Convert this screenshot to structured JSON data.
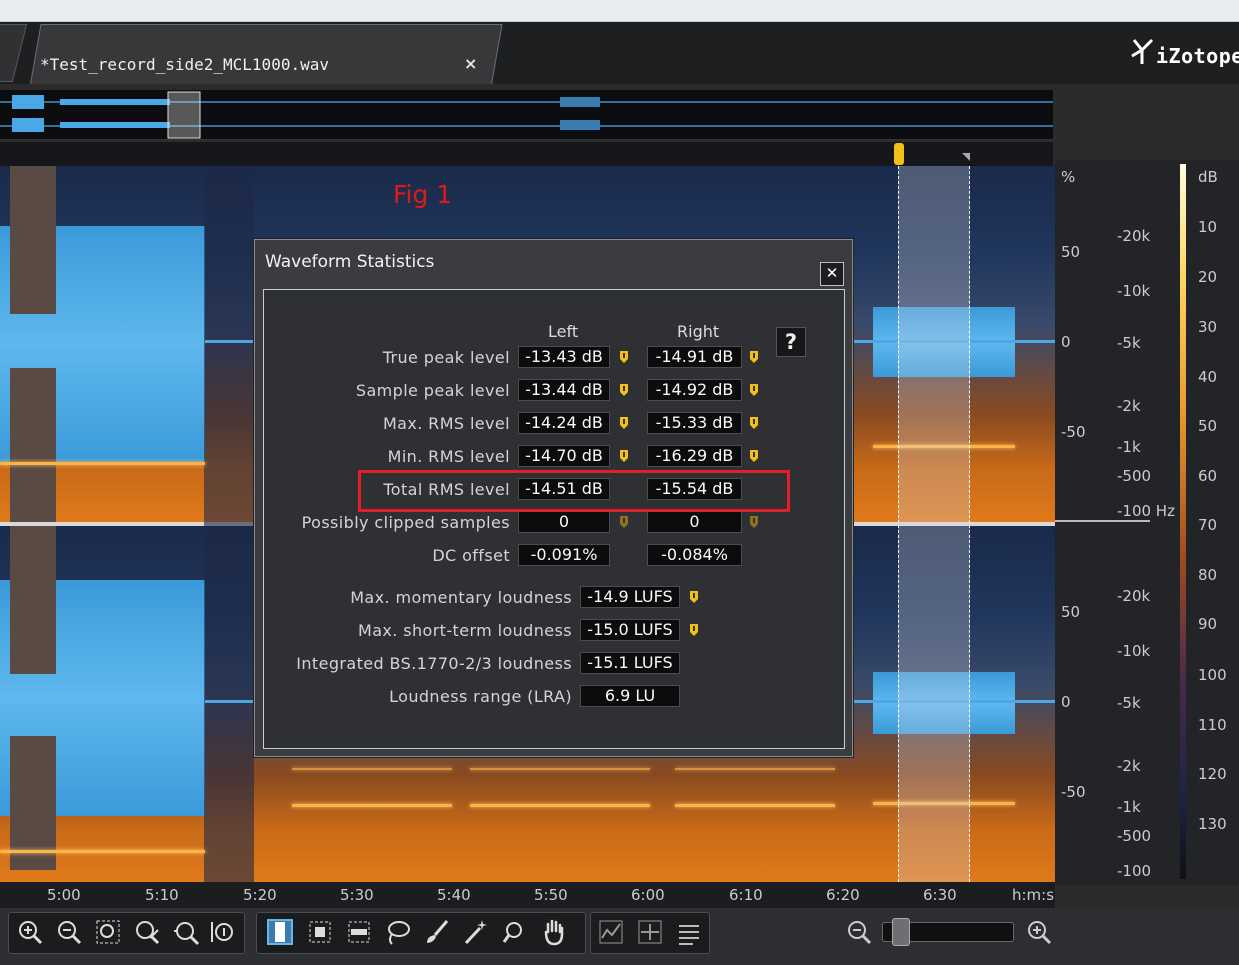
{
  "tab": {
    "filename": "*Test_record_side2_MCL1000.wav",
    "close": "×"
  },
  "brand": {
    "logo": "iZotope"
  },
  "annotation": {
    "fig": "Fig 1"
  },
  "dialog": {
    "title": "Waveform Statistics",
    "close": "✕",
    "help": "?",
    "columns": {
      "left": "Left",
      "right": "Right"
    },
    "rows": [
      {
        "label": "True peak level",
        "left": "-13.43 dB",
        "right": "-14.91 dB"
      },
      {
        "label": "Sample peak level",
        "left": "-13.44 dB",
        "right": "-14.92 dB"
      },
      {
        "label": "Max. RMS level",
        "left": "-14.24 dB",
        "right": "-15.33 dB"
      },
      {
        "label": "Min. RMS level",
        "left": "-14.70 dB",
        "right": "-16.29 dB"
      },
      {
        "label": "Total RMS level",
        "left": "-14.51 dB",
        "right": "-15.54 dB"
      },
      {
        "label": "Possibly clipped samples",
        "left": "0",
        "right": "0"
      },
      {
        "label": "DC offset",
        "left": "-0.091%",
        "right": "-0.084%"
      }
    ],
    "loudness": [
      {
        "label": "Max. momentary loudness",
        "value": "-14.9 LUFS"
      },
      {
        "label": "Max. short-term loudness",
        "value": "-15.0 LUFS"
      },
      {
        "label": "Integrated BS.1770-2/3 loudness",
        "value": "-15.1 LUFS"
      },
      {
        "label": "Loudness range (LRA)",
        "value": "6.9 LU"
      }
    ]
  },
  "axes": {
    "percent_unit": "%",
    "percent_top": [
      "50",
      "0",
      "-50"
    ],
    "percent_bottom": [
      "50",
      "0",
      "-50"
    ],
    "hz_top": [
      "-20k",
      "-10k",
      "-5k",
      "-2k",
      "-1k",
      "-500",
      "-100 Hz"
    ],
    "hz_bottom": [
      "-20k",
      "-10k",
      "-5k",
      "-2k",
      "-1k",
      "-500",
      "-100"
    ],
    "db_unit": "dB",
    "db": [
      "10",
      "20",
      "30",
      "40",
      "50",
      "60",
      "70",
      "80",
      "90",
      "100",
      "110",
      "120",
      "130"
    ]
  },
  "timeline": {
    "ticks": [
      "5:00",
      "5:10",
      "5:20",
      "5:30",
      "5:40",
      "5:50",
      "6:00",
      "6:10",
      "6:20",
      "6:30"
    ],
    "unit": "h:m:s"
  },
  "colors": {
    "accent_red": "#e21f26",
    "waveform": "#4aa8e6",
    "marker": "#f2c018"
  }
}
